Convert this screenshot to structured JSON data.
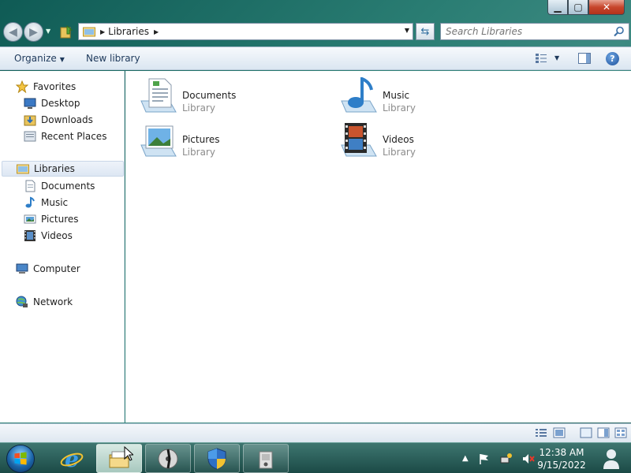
{
  "window": {
    "controls": {
      "minimize": "▁",
      "maximize": "▢",
      "close": "✕"
    }
  },
  "address_bar": {
    "crumb": "Libraries",
    "search_placeholder": "Search Libraries"
  },
  "command_bar": {
    "organize": "Organize",
    "new_library": "New library",
    "help": "?"
  },
  "nav_pane": {
    "favorites": "Favorites",
    "favorites_items": [
      "Desktop",
      "Downloads",
      "Recent Places"
    ],
    "libraries": "Libraries",
    "libraries_items": [
      "Documents",
      "Music",
      "Pictures",
      "Videos"
    ],
    "computer": "Computer",
    "network": "Network"
  },
  "libraries": [
    {
      "name": "Documents",
      "type": "Library",
      "icon": "documents-library-icon"
    },
    {
      "name": "Music",
      "type": "Library",
      "icon": "music-library-icon"
    },
    {
      "name": "Pictures",
      "type": "Library",
      "icon": "pictures-library-icon"
    },
    {
      "name": "Videos",
      "type": "Library",
      "icon": "videos-library-icon"
    }
  ],
  "taskbar": {
    "clock_time": "12:38 AM",
    "clock_date": "9/15/2022",
    "apps": [
      "internet-explorer-icon",
      "windows-explorer-icon",
      "media-player-icon",
      "security-shield-icon",
      "installer-icon"
    ]
  },
  "colors": {
    "accent": "#1e395b",
    "taskbar": "#2b5e59",
    "selection": "#dde7f3"
  }
}
